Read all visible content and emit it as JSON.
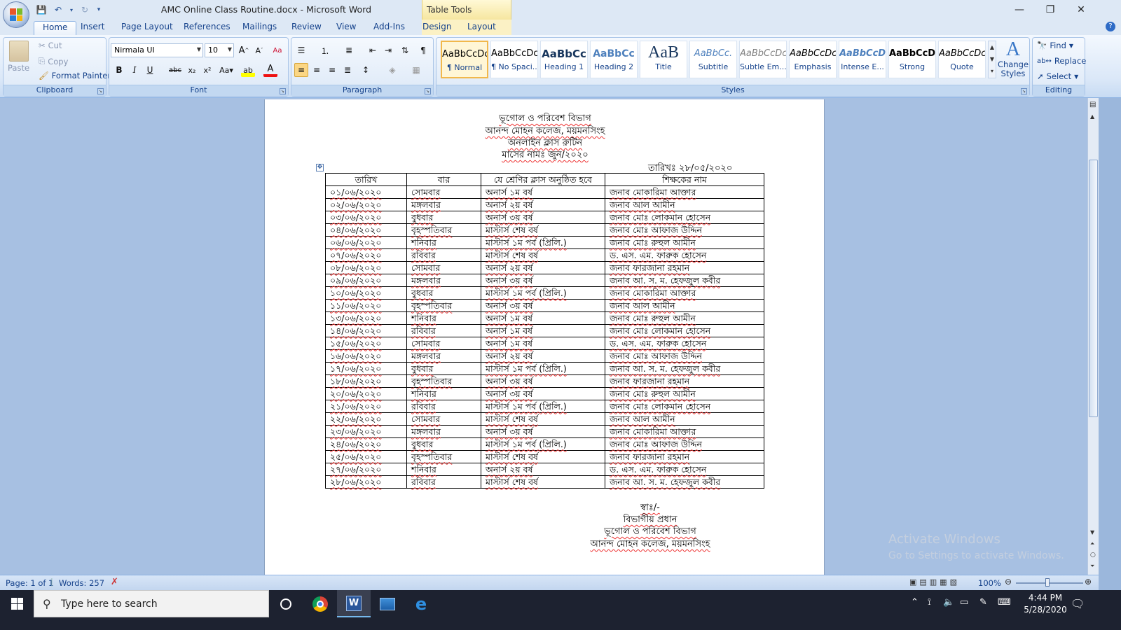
{
  "window": {
    "title": "AMC Online Class Routine.docx - Microsoft Word",
    "table_tools": "Table Tools"
  },
  "tabs": [
    "Home",
    "Insert",
    "Page Layout",
    "References",
    "Mailings",
    "Review",
    "View",
    "Add-Ins",
    "Design",
    "Layout"
  ],
  "active_tab": "Home",
  "ribbon": {
    "clipboard": {
      "paste": "Paste",
      "cut": "Cut",
      "copy": "Copy",
      "format_painter": "Format Painter",
      "label": "Clipboard"
    },
    "font": {
      "name": "Nirmala UI",
      "size": "10",
      "label": "Font"
    },
    "paragraph": {
      "label": "Paragraph"
    },
    "styles": {
      "items": [
        {
          "preview": "AaBbCcDc",
          "name": "¶ Normal"
        },
        {
          "preview": "AaBbCcDc",
          "name": "¶ No Spaci..."
        },
        {
          "preview": "AaBbCc",
          "name": "Heading 1"
        },
        {
          "preview": "AaBbCc",
          "name": "Heading 2"
        },
        {
          "preview": "AaB",
          "name": "Title"
        },
        {
          "preview": "AaBbCc.",
          "name": "Subtitle"
        },
        {
          "preview": "AaBbCcDc",
          "name": "Subtle Em..."
        },
        {
          "preview": "AaBbCcDc",
          "name": "Emphasis"
        },
        {
          "preview": "AaBbCcDc",
          "name": "Intense E..."
        },
        {
          "preview": "AaBbCcDc",
          "name": "Strong"
        },
        {
          "preview": "AaBbCcDc",
          "name": "Quote"
        }
      ],
      "change_styles": "Change Styles",
      "label": "Styles"
    },
    "editing": {
      "find": "Find",
      "replace": "Replace",
      "select": "Select",
      "label": "Editing"
    }
  },
  "document": {
    "header_lines": [
      "ভূগোল ও পরিবেশ বিভাগ",
      "আনন্দ মোহন কলেজ, ময়মনসিংহ",
      "অনলাইন ক্লাস রুটিন",
      "মাসের নামঃ জুন/২০২০"
    ],
    "date_line": "তারিখঃ ২৮/০৫/২০২০",
    "columns": [
      "তারিখ",
      "বার",
      "যে শ্রেণির ক্লাস অনুষ্ঠিত হবে",
      "শিক্ষকের নাম"
    ],
    "rows": [
      [
        "০১/০৬/২০২০",
        "সোমবার",
        "অনার্স ১ম বর্ষ",
        "জনাব মোকারিমা আক্তার"
      ],
      [
        "০২/০৬/২০২০",
        "মঙ্গলবার",
        "অনার্স ২য় বর্ষ",
        "জনাব আল আমীন"
      ],
      [
        "০৩/০৬/২০২০",
        "বুধবার",
        "অনার্স ৩য় বর্ষ",
        "জনাব মোঃ লোকমান হোসেন"
      ],
      [
        "০৪/০৬/২০২০",
        "বৃহস্পতিবার",
        "মাস্টার্স শেষ বর্ষ",
        "জনাব মোঃ আফাজ উদ্দিন"
      ],
      [
        "০৬/০৬/২০২০",
        "শনিবার",
        "মাস্টার্স ১ম পর্ব (প্রিলি.)",
        "জনাব মোঃ রুহুল আমীন"
      ],
      [
        "০৭/০৬/২০২০",
        "রবিবার",
        "মাস্টার্স শেষ বর্ষ",
        "ড. এস. এম. ফারুক হোসেন"
      ],
      [
        "০৮/০৬/২০২০",
        "সোমবার",
        "অনার্স ২য় বর্ষ",
        "জনাব ফারজানা রহমান"
      ],
      [
        "০৯/০৬/২০২০",
        "মঙ্গলবার",
        "অনার্স ৩য় বর্ষ",
        "জনাব আ. স. ম. হেফজুল কবীর"
      ],
      [
        "১০/০৬/২০২০",
        "বুধবার",
        "মাস্টার্স ১ম পর্ব (প্রিলি.)",
        "জনাব মোকারিমা আক্তার"
      ],
      [
        "১১/০৬/২০২০",
        "বৃহস্পতিবার",
        "অনার্স ৩য় বর্ষ",
        "জনাব আল আমীন"
      ],
      [
        "১৩/০৬/২০২০",
        "শনিবার",
        "অনার্স ১ম বর্ষ",
        "জনাব মোঃ রুহুল আমীন"
      ],
      [
        "১৪/০৬/২০২০",
        "রবিবার",
        "অনার্স ১ম বর্ষ",
        "জনাব মোঃ লোকমান হোসেন"
      ],
      [
        "১৫/০৬/২০২০",
        "সোমবার",
        "অনার্স ১ম বর্ষ",
        "ড. এস. এম. ফারুক হোসেন"
      ],
      [
        "১৬/০৬/২০২০",
        "মঙ্গলবার",
        "অনার্স ২য় বর্ষ",
        "জনাব মোঃ আফাজ উদ্দিন"
      ],
      [
        "১৭/০৬/২০২০",
        "বুধবার",
        "মাস্টার্স ১ম পর্ব (প্রিলি.)",
        "জনাব আ. স. ম. হেফজুল কবীর"
      ],
      [
        "১৮/০৬/২০২০",
        "বৃহস্পতিবার",
        "অনার্স ৩য় বর্ষ",
        "জনাব ফারজানা রহমান"
      ],
      [
        "২০/০৬/২০২০",
        "শনিবার",
        "অনার্স ৩য় বর্ষ",
        "জনাব মোঃ রুহুল আমীন"
      ],
      [
        "২১/০৬/২০২০",
        "রবিবার",
        "মাস্টার্স ১ম পর্ব (প্রিলি.)",
        "জনাব মোঃ লোকমান হোসেন"
      ],
      [
        "২২/০৬/২০২০",
        "সোমবার",
        "মাস্টার্স শেষ বর্ষ",
        "জনাব আল আমীন"
      ],
      [
        "২৩/০৬/২০২০",
        "মঙ্গলবার",
        "অনার্স ৩য় বর্ষ",
        "জনাব মোকারিমা আক্তার"
      ],
      [
        "২৪/০৬/২০২০",
        "বুধবার",
        "মাস্টার্স ১ম পর্ব (প্রিলি.)",
        "জনাব মোঃ আফাজ উদ্দিন"
      ],
      [
        "২৫/০৬/২০২০",
        "বৃহস্পতিবার",
        "মাস্টার্স শেষ বর্ষ",
        "জনাব ফারজানা রহমান"
      ],
      [
        "২৭/০৬/২০২০",
        "শনিবার",
        "অনার্স ২য় বর্ষ",
        "ড. এস. এম. ফারুক হোসেন"
      ],
      [
        "২৮/০৬/২০২০",
        "রবিবার",
        "মাস্টার্স শেষ বর্ষ",
        "জনাব আ. স. ম. হেফজুল কবীর"
      ]
    ],
    "signature_lines": [
      "স্বাঃ/-",
      "বিভাগীয় প্রধান",
      "ভূগোল ও পরিবেশ বিভাগ",
      "আনন্দ মোহন কলেজ, ময়মনসিংহ"
    ]
  },
  "watermark": {
    "line1": "Activate Windows",
    "line2": "Go to Settings to activate Windows."
  },
  "statusbar": {
    "page": "Page: 1 of 1",
    "words": "Words: 257",
    "zoom": "100%"
  },
  "taskbar": {
    "search_placeholder": "Type here to search",
    "time": "4:44 PM",
    "date": "5/28/2020"
  }
}
